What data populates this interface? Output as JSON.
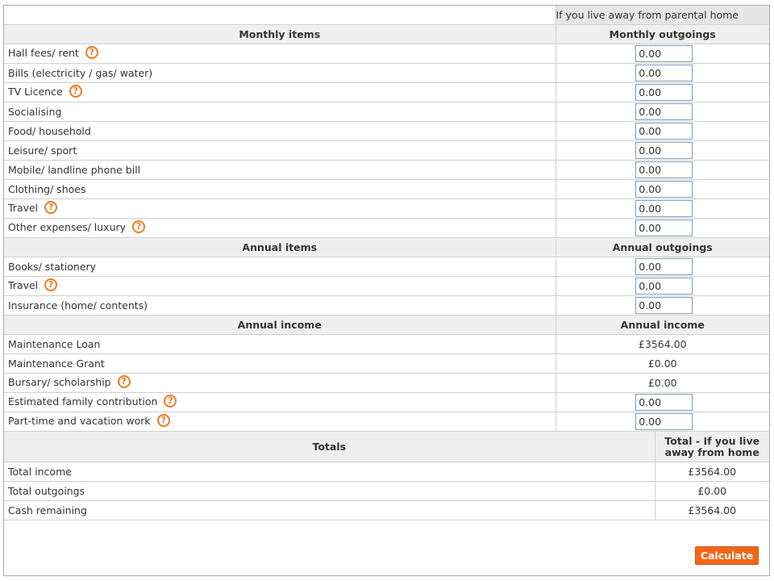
{
  "header": {
    "away_label": "If you live away from parental home"
  },
  "monthly": {
    "items_header": "Monthly items",
    "outgoings_header": "Monthly outgoings",
    "rows": [
      {
        "label": "Hall fees/ rent",
        "value": "0.00",
        "help": true
      },
      {
        "label": "Bills (electricity / gas/ water)",
        "value": "0.00",
        "help": false
      },
      {
        "label": "TV Licence",
        "value": "0.00",
        "help": true
      },
      {
        "label": "Socialising",
        "value": "0.00",
        "help": false
      },
      {
        "label": "Food/ household",
        "value": "0.00",
        "help": false
      },
      {
        "label": "Leisure/ sport",
        "value": "0.00",
        "help": false
      },
      {
        "label": "Mobile/ landline phone bill",
        "value": "0.00",
        "help": false
      },
      {
        "label": "Clothing/ shoes",
        "value": "0.00",
        "help": false
      },
      {
        "label": "Travel",
        "value": "0.00",
        "help": true
      },
      {
        "label": "Other expenses/ luxury",
        "value": "0.00",
        "help": true
      }
    ]
  },
  "annual_out": {
    "items_header": "Annual items",
    "outgoings_header": "Annual outgoings",
    "rows": [
      {
        "label": "Books/ stationery",
        "value": "0.00",
        "help": false
      },
      {
        "label": "Travel",
        "value": "0.00",
        "help": true
      },
      {
        "label": "Insurance (home/ contents)",
        "value": "0.00",
        "help": false
      }
    ]
  },
  "annual_income": {
    "items_header": "Annual income",
    "income_header": "Annual income",
    "rows": [
      {
        "label": "Maintenance Loan",
        "value": "£3564.00",
        "help": false,
        "editable": false
      },
      {
        "label": "Maintenance Grant",
        "value": "£0.00",
        "help": false,
        "editable": false
      },
      {
        "label": "Bursary/ scholarship",
        "value": "£0.00",
        "help": true,
        "editable": false
      },
      {
        "label": "Estimated family contribution",
        "value": "0.00",
        "help": true,
        "editable": true
      },
      {
        "label": "Part-time and vacation work",
        "value": "0.00",
        "help": true,
        "editable": true
      }
    ]
  },
  "totals": {
    "header": "Totals",
    "col_header": "Total - If you live away from home",
    "rows": [
      {
        "label": "Total income",
        "value": "£3564.00"
      },
      {
        "label": "Total outgoings",
        "value": "£0.00"
      },
      {
        "label": "Cash remaining",
        "value": "£3564.00"
      }
    ]
  },
  "help_glyph": "?",
  "calculate_label": "Calculate",
  "colors": {
    "accent": "#f2661c",
    "help": "#f07a20",
    "header_bg": "#efefef",
    "border": "#cfcfcf"
  }
}
